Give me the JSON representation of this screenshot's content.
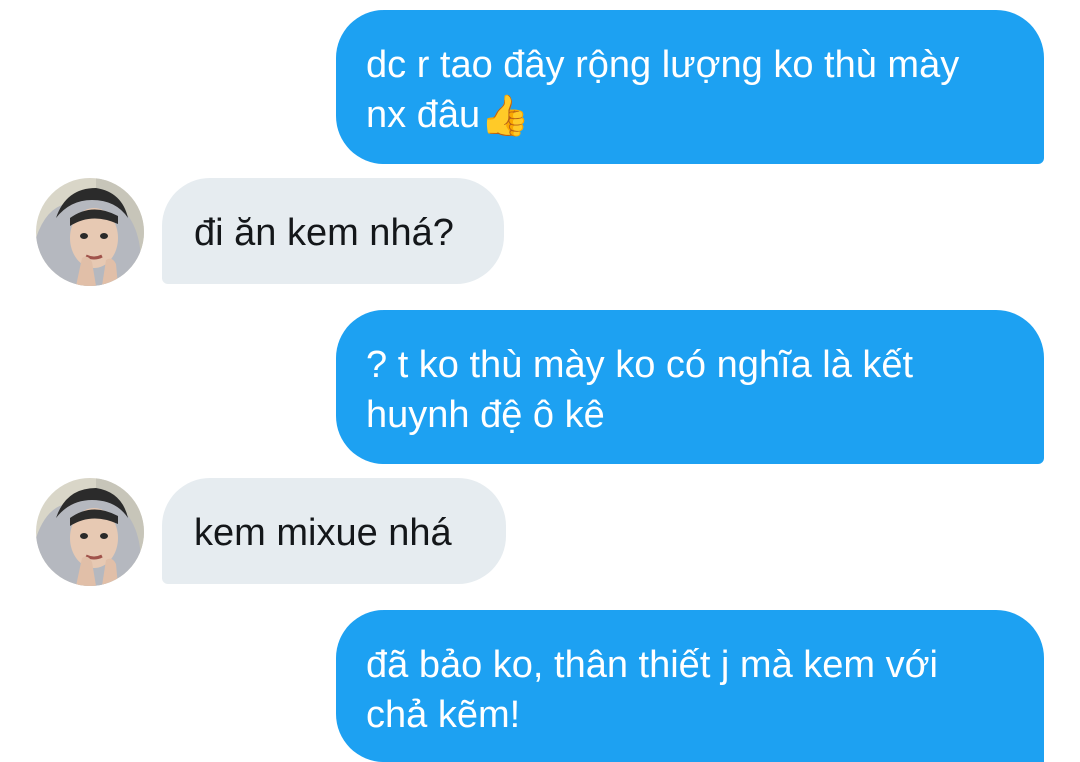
{
  "conversation": {
    "messages": [
      {
        "sender": "me",
        "lines": [
          "dc r tao đây rộng lượng ko thù mày",
          "nx đâu"
        ],
        "emoji": "👍",
        "emoji_name": "thumbs-up"
      },
      {
        "sender": "them",
        "lines": [
          "đi ăn kem nhá?"
        ]
      },
      {
        "sender": "me",
        "lines": [
          "? t ko thù mày ko có nghĩa là kết",
          "huynh đệ ô kê"
        ]
      },
      {
        "sender": "them",
        "lines": [
          "kem mixue nhá"
        ]
      },
      {
        "sender": "me",
        "lines": [
          "đã bảo ko, thân thiết j mà kem với",
          "chả kẽm!"
        ]
      }
    ]
  },
  "colors": {
    "outgoing_bubble": "#1da1f2",
    "incoming_bubble": "#e6ecf0",
    "outgoing_text": "#ffffff",
    "incoming_text": "#14171a"
  }
}
